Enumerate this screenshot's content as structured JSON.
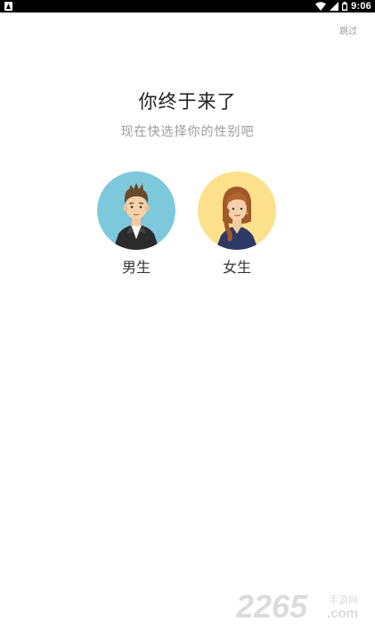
{
  "status_bar": {
    "time": "9:06"
  },
  "header": {
    "skip_label": "跳过"
  },
  "main": {
    "title": "你终于来了",
    "subtitle": "现在快选择你的性别吧",
    "options": [
      {
        "label": "男生",
        "icon": "male-avatar-icon",
        "bg_color": "#7ec8dc"
      },
      {
        "label": "女生",
        "icon": "female-avatar-icon",
        "bg_color": "#fde08b"
      }
    ]
  },
  "watermark": {
    "number": "2265",
    "suffix": ".com",
    "cn": "手游网",
    "color": "#dcdcdc"
  }
}
